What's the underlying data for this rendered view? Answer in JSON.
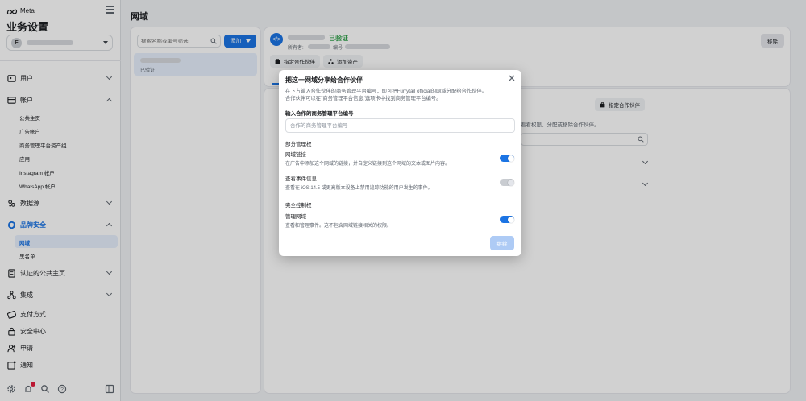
{
  "sidebar": {
    "brand": "Meta",
    "title": "业务设置",
    "account_initial": "F",
    "items": [
      {
        "label": "用户",
        "icon": "users-icon"
      },
      {
        "label": "帐户",
        "icon": "accounts-icon"
      },
      {
        "label": "数据源",
        "icon": "data-sources-icon"
      },
      {
        "label": "品牌安全",
        "icon": "brand-safety-icon"
      },
      {
        "label": "认证的公共主页",
        "icon": "verified-page-icon"
      },
      {
        "label": "集成",
        "icon": "integrations-icon"
      },
      {
        "label": "支付方式",
        "icon": "payment-icon"
      },
      {
        "label": "安全中心",
        "icon": "security-center-icon"
      },
      {
        "label": "申请",
        "icon": "requests-icon"
      },
      {
        "label": "通知",
        "icon": "notifications-icon"
      }
    ],
    "account_subitems": [
      "公共主页",
      "广告帐户",
      "商务管理平台资产组",
      "应用",
      "Instagram 帐户",
      "WhatsApp 帐户"
    ],
    "brand_safety_subitems": [
      "网域",
      "黑名单"
    ]
  },
  "main": {
    "title": "网域",
    "search_placeholder": "搜索名称或编号筛选",
    "add_button": "添加",
    "domain_status": "已验证",
    "detail": {
      "status": "已验证",
      "owner_label": "所有者:",
      "id_label": "编号",
      "remove_button": "移除",
      "assign_partner": "指定合作伙伴",
      "add_asset": "添加资产"
    },
    "content": {
      "assign_partner": "指定合作伙伴",
      "text": "看看权限、分配或移除合作伙伴。"
    }
  },
  "modal": {
    "title": "把这一网域分享给合作伙伴",
    "desc_line1": "在下方输入合作伙伴的商务管理平台编号，即可把Furrytail official的网域分配给合作伙伴。",
    "desc_line2": "合作伙伴可以在\"商务管理平台信息\"选项卡中找到商务管理平台编号。",
    "input_label": "输入合作的商务管理平台编号",
    "input_placeholder": "合作的商务管理平台编号",
    "partial_section": "部分管理权",
    "perm1_title": "网域链接",
    "perm1_desc": "在广告中添加这个网域的链接，并自定义链接到这个网域的文本或图片内容。",
    "perm1_on": true,
    "perm2_title": "查看事件信息",
    "perm2_desc": "查看在 iOS 14.5 或更高版本设备上禁用追踪功能的用户发生的事件。",
    "perm2_on": false,
    "full_section": "完全控制权",
    "perm3_title": "管理网域",
    "perm3_desc": "查看和管理事件。这不包含网域链接相关的权限。",
    "perm3_on": true,
    "confirm_button": "继续"
  },
  "colors": {
    "accent": "#1b74e4",
    "verified": "#31a24c",
    "active_bg": "#e7f0fd"
  }
}
